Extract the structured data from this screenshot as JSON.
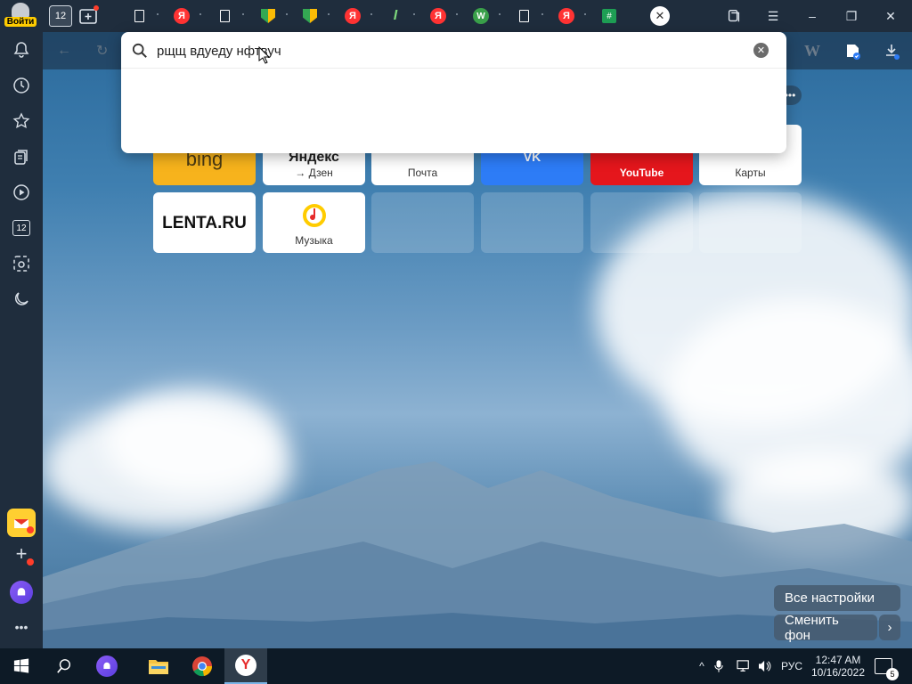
{
  "browser": {
    "login_label": "Войти",
    "tab_count": "12",
    "tabs": [
      {
        "kind": "doc"
      },
      {
        "kind": "yandex",
        "text": "Я"
      },
      {
        "kind": "doc"
      },
      {
        "kind": "gdrive"
      },
      {
        "kind": "gdrive"
      },
      {
        "kind": "yandex",
        "text": "Я"
      },
      {
        "kind": "italic",
        "text": "I"
      },
      {
        "kind": "yandex",
        "text": "Я"
      },
      {
        "kind": "wp",
        "text": "W"
      },
      {
        "kind": "doc"
      },
      {
        "kind": "yandex",
        "text": "Я"
      },
      {
        "kind": "sheet",
        "text": "#"
      }
    ],
    "window_controls": {
      "minimize": "–",
      "restore": "❐",
      "close": "✕"
    }
  },
  "search": {
    "value": "рщщ вдуеду нфтвуч",
    "clear_icon": "✕"
  },
  "sidebar": {
    "sidebar_counter": "12"
  },
  "tiles": {
    "row1": [
      {
        "label": "",
        "logo": "bing",
        "bg": "#f7b31c"
      },
      {
        "label": "→ Дзен",
        "logo": "Яндекс",
        "bg": "#ffffff"
      },
      {
        "label": "Почта",
        "logo": "",
        "bg": "#ffffff"
      },
      {
        "label": "",
        "logo": "VK",
        "bg": "#2d7cf6"
      },
      {
        "label": "YouTube",
        "logo": "",
        "bg": "#e5161c"
      },
      {
        "label": "Карты",
        "logo": "",
        "bg": "#ffffff"
      }
    ],
    "row2": [
      {
        "label": "",
        "logo": "LENTA.RU"
      },
      {
        "label": "Музыка",
        "logo": ""
      }
    ]
  },
  "actions": {
    "all_settings": "Все настройки",
    "change_bg": "Сменить фон"
  },
  "taskbar": {
    "lang": "РУС",
    "time": "12:47 AM",
    "date": "10/16/2022",
    "notifications": "5"
  },
  "colors": {
    "yandex_red": "#ff3333",
    "mail_yellow": "#ffcf31",
    "alice_purple": "#6d4ae8"
  }
}
